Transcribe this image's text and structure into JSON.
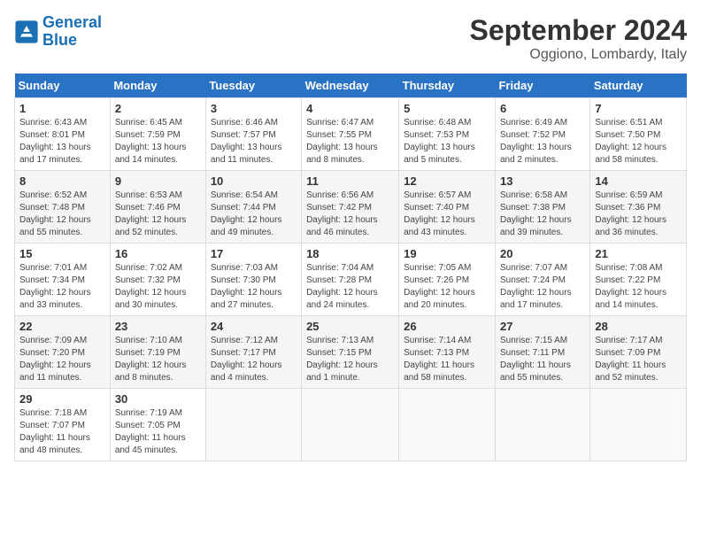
{
  "header": {
    "logo_line1": "General",
    "logo_line2": "Blue",
    "month": "September 2024",
    "location": "Oggiono, Lombardy, Italy"
  },
  "days_of_week": [
    "Sunday",
    "Monday",
    "Tuesday",
    "Wednesday",
    "Thursday",
    "Friday",
    "Saturday"
  ],
  "weeks": [
    [
      {
        "num": "1",
        "sunrise": "6:43 AM",
        "sunset": "8:01 PM",
        "daylight": "13 hours and 17 minutes."
      },
      {
        "num": "2",
        "sunrise": "6:45 AM",
        "sunset": "7:59 PM",
        "daylight": "13 hours and 14 minutes."
      },
      {
        "num": "3",
        "sunrise": "6:46 AM",
        "sunset": "7:57 PM",
        "daylight": "13 hours and 11 minutes."
      },
      {
        "num": "4",
        "sunrise": "6:47 AM",
        "sunset": "7:55 PM",
        "daylight": "13 hours and 8 minutes."
      },
      {
        "num": "5",
        "sunrise": "6:48 AM",
        "sunset": "7:53 PM",
        "daylight": "13 hours and 5 minutes."
      },
      {
        "num": "6",
        "sunrise": "6:49 AM",
        "sunset": "7:52 PM",
        "daylight": "13 hours and 2 minutes."
      },
      {
        "num": "7",
        "sunrise": "6:51 AM",
        "sunset": "7:50 PM",
        "daylight": "12 hours and 58 minutes."
      }
    ],
    [
      {
        "num": "8",
        "sunrise": "6:52 AM",
        "sunset": "7:48 PM",
        "daylight": "12 hours and 55 minutes."
      },
      {
        "num": "9",
        "sunrise": "6:53 AM",
        "sunset": "7:46 PM",
        "daylight": "12 hours and 52 minutes."
      },
      {
        "num": "10",
        "sunrise": "6:54 AM",
        "sunset": "7:44 PM",
        "daylight": "12 hours and 49 minutes."
      },
      {
        "num": "11",
        "sunrise": "6:56 AM",
        "sunset": "7:42 PM",
        "daylight": "12 hours and 46 minutes."
      },
      {
        "num": "12",
        "sunrise": "6:57 AM",
        "sunset": "7:40 PM",
        "daylight": "12 hours and 43 minutes."
      },
      {
        "num": "13",
        "sunrise": "6:58 AM",
        "sunset": "7:38 PM",
        "daylight": "12 hours and 39 minutes."
      },
      {
        "num": "14",
        "sunrise": "6:59 AM",
        "sunset": "7:36 PM",
        "daylight": "12 hours and 36 minutes."
      }
    ],
    [
      {
        "num": "15",
        "sunrise": "7:01 AM",
        "sunset": "7:34 PM",
        "daylight": "12 hours and 33 minutes."
      },
      {
        "num": "16",
        "sunrise": "7:02 AM",
        "sunset": "7:32 PM",
        "daylight": "12 hours and 30 minutes."
      },
      {
        "num": "17",
        "sunrise": "7:03 AM",
        "sunset": "7:30 PM",
        "daylight": "12 hours and 27 minutes."
      },
      {
        "num": "18",
        "sunrise": "7:04 AM",
        "sunset": "7:28 PM",
        "daylight": "12 hours and 24 minutes."
      },
      {
        "num": "19",
        "sunrise": "7:05 AM",
        "sunset": "7:26 PM",
        "daylight": "12 hours and 20 minutes."
      },
      {
        "num": "20",
        "sunrise": "7:07 AM",
        "sunset": "7:24 PM",
        "daylight": "12 hours and 17 minutes."
      },
      {
        "num": "21",
        "sunrise": "7:08 AM",
        "sunset": "7:22 PM",
        "daylight": "12 hours and 14 minutes."
      }
    ],
    [
      {
        "num": "22",
        "sunrise": "7:09 AM",
        "sunset": "7:20 PM",
        "daylight": "12 hours and 11 minutes."
      },
      {
        "num": "23",
        "sunrise": "7:10 AM",
        "sunset": "7:19 PM",
        "daylight": "12 hours and 8 minutes."
      },
      {
        "num": "24",
        "sunrise": "7:12 AM",
        "sunset": "7:17 PM",
        "daylight": "12 hours and 4 minutes."
      },
      {
        "num": "25",
        "sunrise": "7:13 AM",
        "sunset": "7:15 PM",
        "daylight": "12 hours and 1 minute."
      },
      {
        "num": "26",
        "sunrise": "7:14 AM",
        "sunset": "7:13 PM",
        "daylight": "11 hours and 58 minutes."
      },
      {
        "num": "27",
        "sunrise": "7:15 AM",
        "sunset": "7:11 PM",
        "daylight": "11 hours and 55 minutes."
      },
      {
        "num": "28",
        "sunrise": "7:17 AM",
        "sunset": "7:09 PM",
        "daylight": "11 hours and 52 minutes."
      }
    ],
    [
      {
        "num": "29",
        "sunrise": "7:18 AM",
        "sunset": "7:07 PM",
        "daylight": "11 hours and 48 minutes."
      },
      {
        "num": "30",
        "sunrise": "7:19 AM",
        "sunset": "7:05 PM",
        "daylight": "11 hours and 45 minutes."
      },
      null,
      null,
      null,
      null,
      null
    ]
  ]
}
